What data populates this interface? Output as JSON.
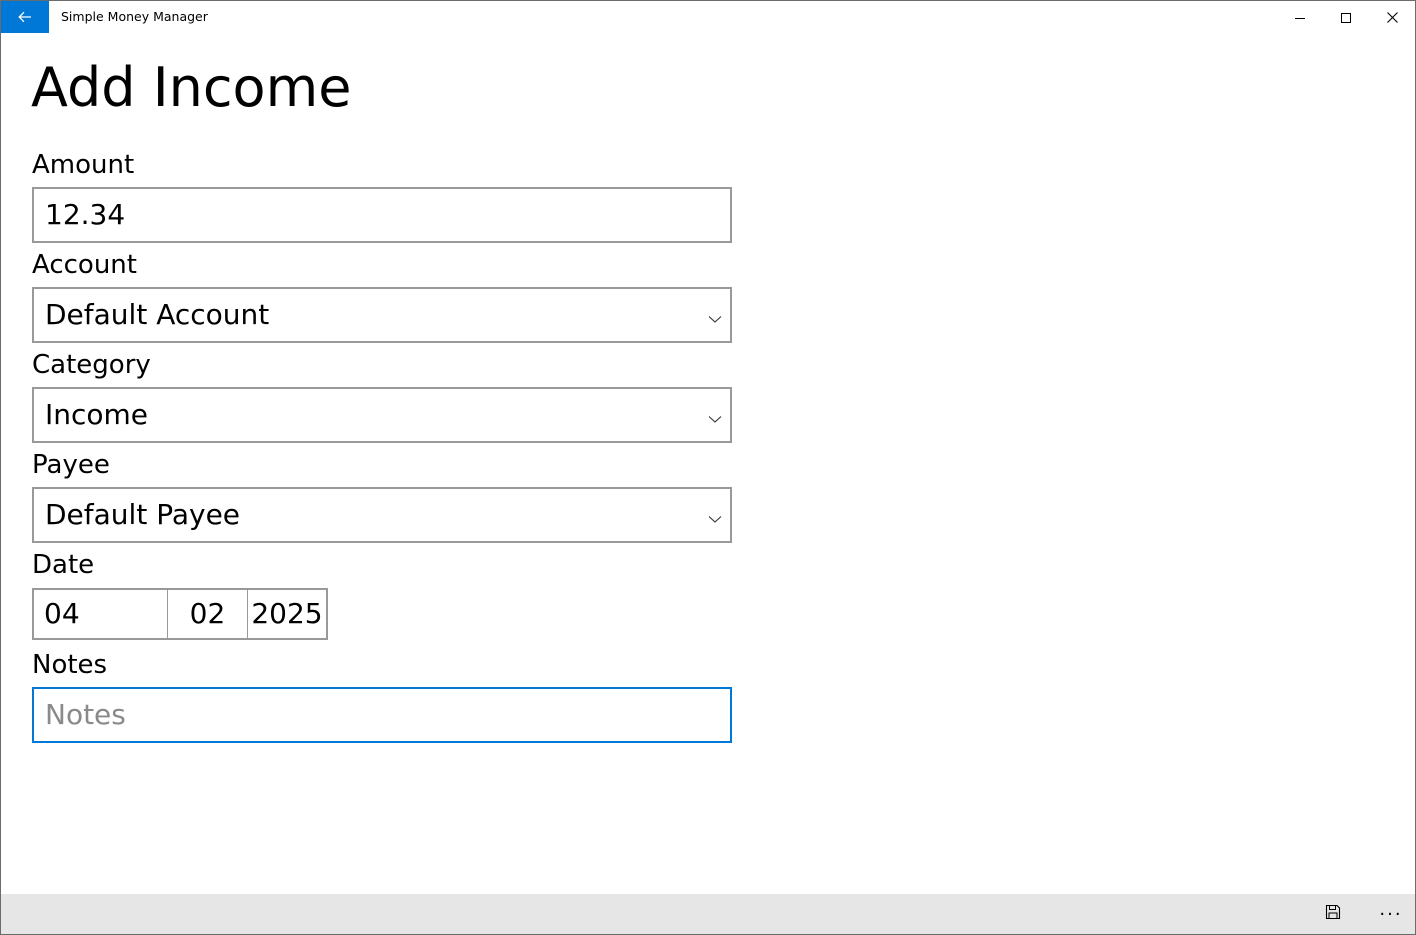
{
  "window": {
    "title": "Simple Money Manager",
    "accent_color": "#0078d7"
  },
  "icons": {
    "back": "back-arrow-icon",
    "minimize": "minimize-icon",
    "maximize": "maximize-icon",
    "close": "close-icon",
    "dropdown": "chevron-down-icon",
    "save": "save-icon",
    "more": "more-icon"
  },
  "page": {
    "title": "Add Income"
  },
  "form": {
    "amount": {
      "label": "Amount",
      "value": "12.34"
    },
    "account": {
      "label": "Account",
      "selected": "Default Account"
    },
    "category": {
      "label": "Category",
      "selected": "Income"
    },
    "payee": {
      "label": "Payee",
      "selected": "Default Payee"
    },
    "date": {
      "label": "Date",
      "day": "04",
      "month": "02",
      "year": "2025"
    },
    "notes": {
      "label": "Notes",
      "value": "",
      "placeholder": "Notes"
    }
  },
  "command_bar": {
    "more_label": "···"
  }
}
